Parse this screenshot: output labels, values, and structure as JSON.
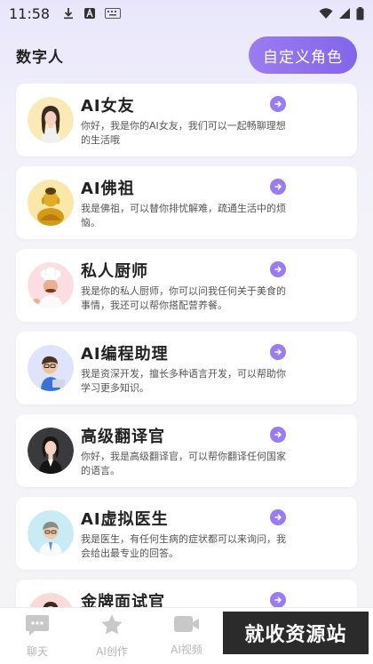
{
  "status_bar": {
    "time": "11:58",
    "left_icons": [
      "download-icon",
      "a-badge-icon",
      "keyboard-icon"
    ],
    "right_icons": [
      "wifi-icon",
      "signal-icon",
      "battery-icon"
    ]
  },
  "header": {
    "title": "数字人",
    "custom_role_button": "自定义角色"
  },
  "characters": [
    {
      "name": "AI女友",
      "desc": "你好，我是你的AI女友，我们可以一起畅聊理想的生活哦",
      "avatar": "woman-avatar"
    },
    {
      "name": "AI佛祖",
      "desc": "我是佛祖，可以替你排忧解难，疏通生活中的烦恼。",
      "avatar": "buddha-avatar"
    },
    {
      "name": "私人厨师",
      "desc": "我是你的私人厨师，你可以问我任何关于美食的事情，我还可以帮你搭配营养餐。",
      "avatar": "chef-avatar"
    },
    {
      "name": "AI编程助理",
      "desc": "我是资深开发，擅长多种语言开发，可以帮助你学习更多知识。",
      "avatar": "programmer-avatar"
    },
    {
      "name": "高级翻译官",
      "desc": "你好，我是高级翻译官，可以帮你翻译任何国家的语言。",
      "avatar": "translator-avatar"
    },
    {
      "name": "AI虚拟医生",
      "desc": "我是医生，有任何生病的症状都可以来询问，我会给出最专业的回答。",
      "avatar": "doctor-avatar"
    },
    {
      "name": "金牌面试官",
      "desc": "",
      "avatar": "interviewer-avatar"
    }
  ],
  "tabbar": {
    "tabs": [
      {
        "label": "聊天",
        "icon": "chat-icon"
      },
      {
        "label": "AI创作",
        "icon": "star-icon"
      },
      {
        "label": "AI视频",
        "icon": "video-icon"
      }
    ]
  },
  "watermark": "就收资源站",
  "colors": {
    "accent": "#8a6cec",
    "card_bg": "#ffffff",
    "tab_inactive": "#b5b5b5"
  }
}
